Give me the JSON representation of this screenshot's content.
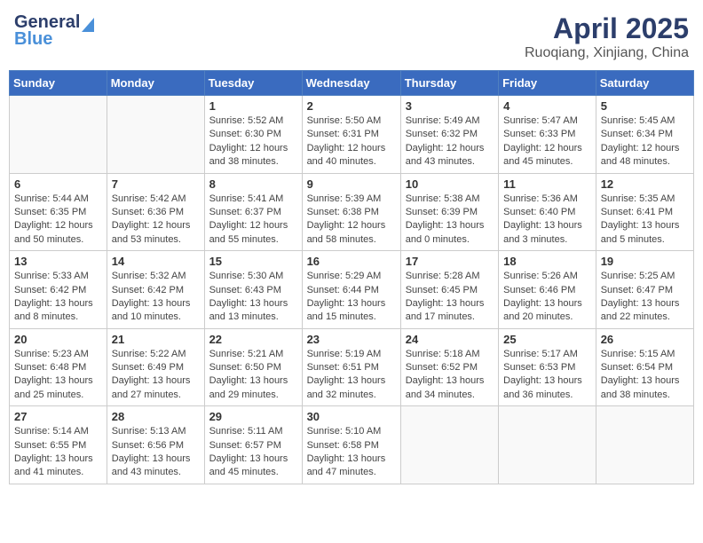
{
  "header": {
    "logo_general": "General",
    "logo_blue": "Blue",
    "month_title": "April 2025",
    "location": "Ruoqiang, Xinjiang, China"
  },
  "weekdays": [
    "Sunday",
    "Monday",
    "Tuesday",
    "Wednesday",
    "Thursday",
    "Friday",
    "Saturday"
  ],
  "weeks": [
    [
      {
        "day": "",
        "sunrise": "",
        "sunset": "",
        "daylight": ""
      },
      {
        "day": "",
        "sunrise": "",
        "sunset": "",
        "daylight": ""
      },
      {
        "day": "1",
        "sunrise": "Sunrise: 5:52 AM",
        "sunset": "Sunset: 6:30 PM",
        "daylight": "Daylight: 12 hours and 38 minutes."
      },
      {
        "day": "2",
        "sunrise": "Sunrise: 5:50 AM",
        "sunset": "Sunset: 6:31 PM",
        "daylight": "Daylight: 12 hours and 40 minutes."
      },
      {
        "day": "3",
        "sunrise": "Sunrise: 5:49 AM",
        "sunset": "Sunset: 6:32 PM",
        "daylight": "Daylight: 12 hours and 43 minutes."
      },
      {
        "day": "4",
        "sunrise": "Sunrise: 5:47 AM",
        "sunset": "Sunset: 6:33 PM",
        "daylight": "Daylight: 12 hours and 45 minutes."
      },
      {
        "day": "5",
        "sunrise": "Sunrise: 5:45 AM",
        "sunset": "Sunset: 6:34 PM",
        "daylight": "Daylight: 12 hours and 48 minutes."
      }
    ],
    [
      {
        "day": "6",
        "sunrise": "Sunrise: 5:44 AM",
        "sunset": "Sunset: 6:35 PM",
        "daylight": "Daylight: 12 hours and 50 minutes."
      },
      {
        "day": "7",
        "sunrise": "Sunrise: 5:42 AM",
        "sunset": "Sunset: 6:36 PM",
        "daylight": "Daylight: 12 hours and 53 minutes."
      },
      {
        "day": "8",
        "sunrise": "Sunrise: 5:41 AM",
        "sunset": "Sunset: 6:37 PM",
        "daylight": "Daylight: 12 hours and 55 minutes."
      },
      {
        "day": "9",
        "sunrise": "Sunrise: 5:39 AM",
        "sunset": "Sunset: 6:38 PM",
        "daylight": "Daylight: 12 hours and 58 minutes."
      },
      {
        "day": "10",
        "sunrise": "Sunrise: 5:38 AM",
        "sunset": "Sunset: 6:39 PM",
        "daylight": "Daylight: 13 hours and 0 minutes."
      },
      {
        "day": "11",
        "sunrise": "Sunrise: 5:36 AM",
        "sunset": "Sunset: 6:40 PM",
        "daylight": "Daylight: 13 hours and 3 minutes."
      },
      {
        "day": "12",
        "sunrise": "Sunrise: 5:35 AM",
        "sunset": "Sunset: 6:41 PM",
        "daylight": "Daylight: 13 hours and 5 minutes."
      }
    ],
    [
      {
        "day": "13",
        "sunrise": "Sunrise: 5:33 AM",
        "sunset": "Sunset: 6:42 PM",
        "daylight": "Daylight: 13 hours and 8 minutes."
      },
      {
        "day": "14",
        "sunrise": "Sunrise: 5:32 AM",
        "sunset": "Sunset: 6:42 PM",
        "daylight": "Daylight: 13 hours and 10 minutes."
      },
      {
        "day": "15",
        "sunrise": "Sunrise: 5:30 AM",
        "sunset": "Sunset: 6:43 PM",
        "daylight": "Daylight: 13 hours and 13 minutes."
      },
      {
        "day": "16",
        "sunrise": "Sunrise: 5:29 AM",
        "sunset": "Sunset: 6:44 PM",
        "daylight": "Daylight: 13 hours and 15 minutes."
      },
      {
        "day": "17",
        "sunrise": "Sunrise: 5:28 AM",
        "sunset": "Sunset: 6:45 PM",
        "daylight": "Daylight: 13 hours and 17 minutes."
      },
      {
        "day": "18",
        "sunrise": "Sunrise: 5:26 AM",
        "sunset": "Sunset: 6:46 PM",
        "daylight": "Daylight: 13 hours and 20 minutes."
      },
      {
        "day": "19",
        "sunrise": "Sunrise: 5:25 AM",
        "sunset": "Sunset: 6:47 PM",
        "daylight": "Daylight: 13 hours and 22 minutes."
      }
    ],
    [
      {
        "day": "20",
        "sunrise": "Sunrise: 5:23 AM",
        "sunset": "Sunset: 6:48 PM",
        "daylight": "Daylight: 13 hours and 25 minutes."
      },
      {
        "day": "21",
        "sunrise": "Sunrise: 5:22 AM",
        "sunset": "Sunset: 6:49 PM",
        "daylight": "Daylight: 13 hours and 27 minutes."
      },
      {
        "day": "22",
        "sunrise": "Sunrise: 5:21 AM",
        "sunset": "Sunset: 6:50 PM",
        "daylight": "Daylight: 13 hours and 29 minutes."
      },
      {
        "day": "23",
        "sunrise": "Sunrise: 5:19 AM",
        "sunset": "Sunset: 6:51 PM",
        "daylight": "Daylight: 13 hours and 32 minutes."
      },
      {
        "day": "24",
        "sunrise": "Sunrise: 5:18 AM",
        "sunset": "Sunset: 6:52 PM",
        "daylight": "Daylight: 13 hours and 34 minutes."
      },
      {
        "day": "25",
        "sunrise": "Sunrise: 5:17 AM",
        "sunset": "Sunset: 6:53 PM",
        "daylight": "Daylight: 13 hours and 36 minutes."
      },
      {
        "day": "26",
        "sunrise": "Sunrise: 5:15 AM",
        "sunset": "Sunset: 6:54 PM",
        "daylight": "Daylight: 13 hours and 38 minutes."
      }
    ],
    [
      {
        "day": "27",
        "sunrise": "Sunrise: 5:14 AM",
        "sunset": "Sunset: 6:55 PM",
        "daylight": "Daylight: 13 hours and 41 minutes."
      },
      {
        "day": "28",
        "sunrise": "Sunrise: 5:13 AM",
        "sunset": "Sunset: 6:56 PM",
        "daylight": "Daylight: 13 hours and 43 minutes."
      },
      {
        "day": "29",
        "sunrise": "Sunrise: 5:11 AM",
        "sunset": "Sunset: 6:57 PM",
        "daylight": "Daylight: 13 hours and 45 minutes."
      },
      {
        "day": "30",
        "sunrise": "Sunrise: 5:10 AM",
        "sunset": "Sunset: 6:58 PM",
        "daylight": "Daylight: 13 hours and 47 minutes."
      },
      {
        "day": "",
        "sunrise": "",
        "sunset": "",
        "daylight": ""
      },
      {
        "day": "",
        "sunrise": "",
        "sunset": "",
        "daylight": ""
      },
      {
        "day": "",
        "sunrise": "",
        "sunset": "",
        "daylight": ""
      }
    ]
  ]
}
